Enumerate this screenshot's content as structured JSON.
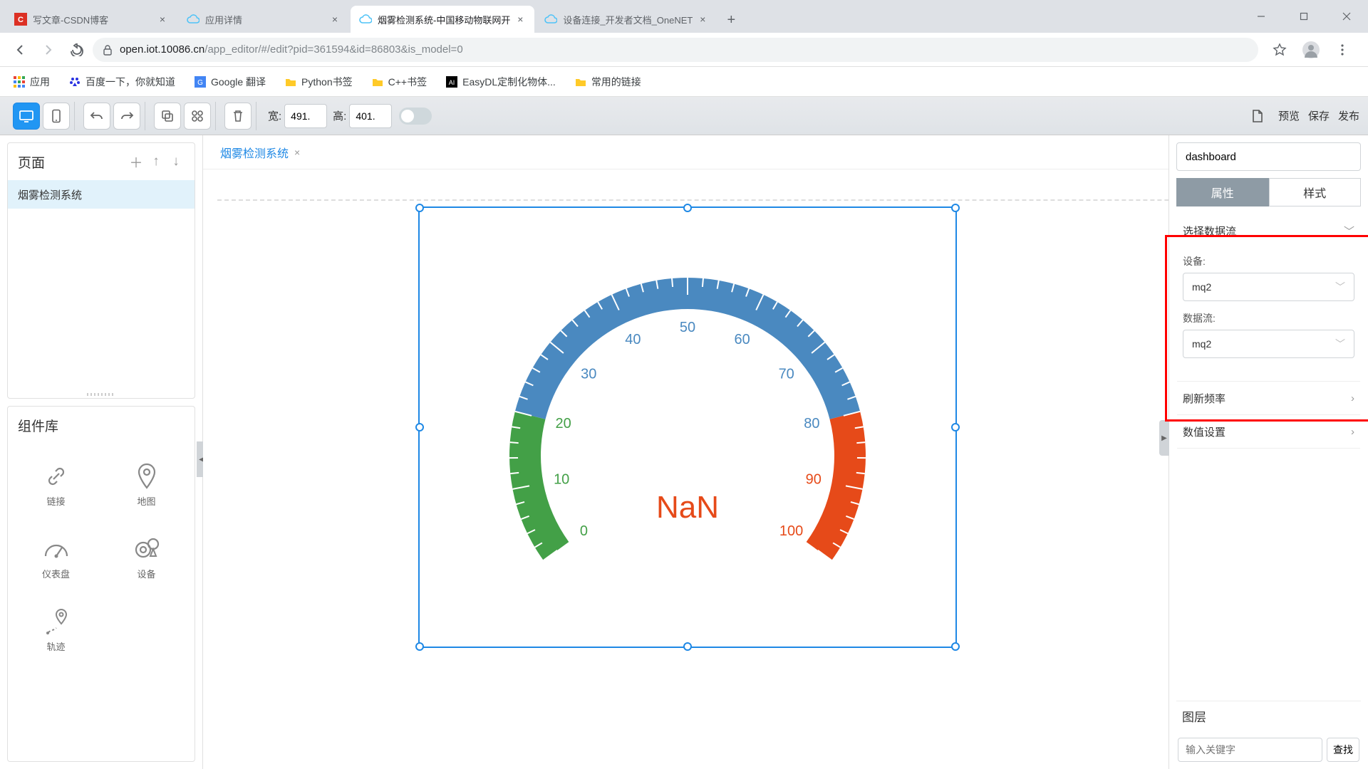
{
  "browser": {
    "tabs": [
      {
        "label": "写文章-CSDN博客",
        "icon": "csdn"
      },
      {
        "label": "应用详情",
        "icon": "cloud"
      },
      {
        "label": "烟雾检测系统-中国移动物联网开",
        "icon": "cloud"
      },
      {
        "label": "设备连接_开发者文档_OneNET",
        "icon": "cloud"
      }
    ],
    "url_host": "open.iot.10086.cn",
    "url_path": "/app_editor/#/edit?pid=361594&id=86803&is_model=0",
    "bookmarks": [
      {
        "label": "应用",
        "icon": "apps"
      },
      {
        "label": "百度一下，你就知道",
        "icon": "baidu"
      },
      {
        "label": "Google 翻译",
        "icon": "gtrans"
      },
      {
        "label": "Python书签",
        "icon": "folder"
      },
      {
        "label": "C++书签",
        "icon": "folder"
      },
      {
        "label": "EasyDL定制化物体...",
        "icon": "ai"
      },
      {
        "label": "常用的链接",
        "icon": "folder"
      }
    ]
  },
  "toolbar": {
    "width_label": "宽:",
    "width_value": "491.",
    "height_label": "高:",
    "height_value": "401.",
    "preview": "预览",
    "save": "保存",
    "publish": "发布"
  },
  "left": {
    "pages_title": "页面",
    "page_item": "烟雾检测系统",
    "complib_title": "组件库",
    "components": [
      {
        "label": "链接",
        "icon": "link"
      },
      {
        "label": "地图",
        "icon": "map"
      },
      {
        "label": "仪表盘",
        "icon": "gauge"
      },
      {
        "label": "设备",
        "icon": "device"
      },
      {
        "label": "轨迹",
        "icon": "track"
      }
    ]
  },
  "canvas": {
    "tab": "烟雾检测系统",
    "gauge_value": "NaN"
  },
  "chart_data": {
    "type": "gauge",
    "value": null,
    "display": "NaN",
    "min": 0,
    "max": 100,
    "ticks": [
      0,
      10,
      20,
      30,
      40,
      50,
      60,
      70,
      80,
      90,
      100
    ],
    "bands": [
      {
        "from": 0,
        "to": 20,
        "color": "#43a047"
      },
      {
        "from": 20,
        "to": 80,
        "color": "#4a89c0"
      },
      {
        "from": 80,
        "to": 100,
        "color": "#e64a19"
      }
    ],
    "start_angle": 216,
    "end_angle": -36
  },
  "right": {
    "name_value": "dashboard",
    "tab_attr": "属性",
    "tab_style": "样式",
    "acc_datastream": "选择数据流",
    "device_label": "设备:",
    "device_value": "mq2",
    "stream_label": "数据流:",
    "stream_value": "mq2",
    "acc_refresh": "刷新频率",
    "acc_number": "数值设置",
    "layer_title": "图层",
    "search_placeholder": "输入关键字",
    "search_btn": "查找"
  }
}
